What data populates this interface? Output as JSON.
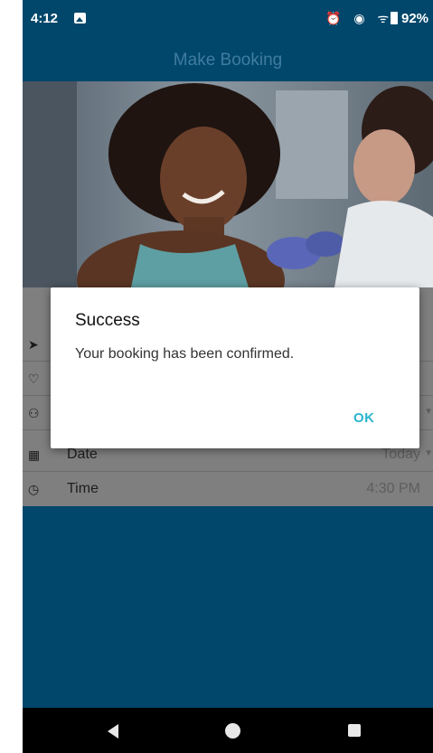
{
  "status_bar": {
    "time": "4:12",
    "icons": "⏰ ◉ ᯤ",
    "battery_text": "92%"
  },
  "header": {
    "title": "Make Booking"
  },
  "form": {
    "rows": [
      {
        "icon": "navigation-icon",
        "label": "",
        "value": ""
      },
      {
        "icon": "heart-rate-icon",
        "label": "",
        "value": ""
      },
      {
        "icon": "person-icon",
        "label": "",
        "value": ""
      },
      {
        "icon": "calendar-icon",
        "label": "Date",
        "value": "Today"
      },
      {
        "icon": "clock-icon",
        "label": "Time",
        "value": "4:30 PM"
      }
    ]
  },
  "dialog": {
    "title": "Success",
    "message": "Your booking has been confirmed.",
    "ok_label": "OK"
  },
  "colors": {
    "primary": "#00476b",
    "title_text": "#3f7ca0",
    "accent": "#2bb5cf",
    "dimmed_form": "#7f7f7f"
  }
}
